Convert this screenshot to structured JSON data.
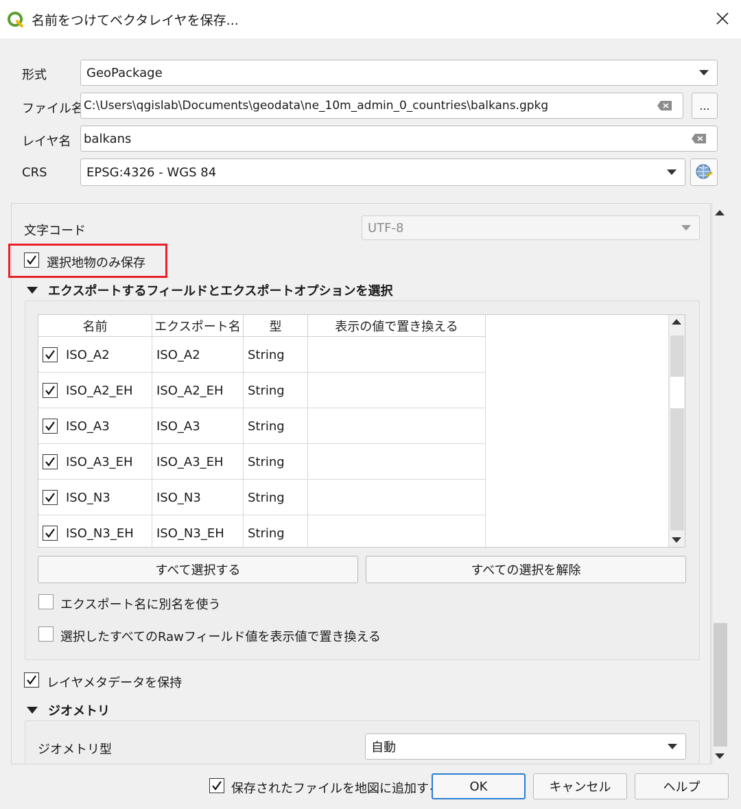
{
  "window": {
    "title": "名前をつけてベクタレイヤを保存..."
  },
  "format": {
    "label": "形式",
    "value": "GeoPackage"
  },
  "filename": {
    "label": "ファイル名",
    "value": "C:\\Users\\qgislab\\Documents\\geodata\\ne_10m_admin_0_countries\\balkans.gpkg",
    "browse_label": "..."
  },
  "layername": {
    "label": "レイヤ名",
    "value": "balkans"
  },
  "crs": {
    "label": "CRS",
    "value": "EPSG:4326 - WGS 84"
  },
  "encoding": {
    "label": "文字コード",
    "value": "UTF-8"
  },
  "selected_only": {
    "label": "選択地物のみ保存",
    "checked": true
  },
  "fields_section": {
    "title": "エクスポートするフィールドとエクスポートオプションを選択",
    "columns": [
      "名前",
      "エクスポート名",
      "型",
      "表示の値で置き換える"
    ],
    "rows": [
      {
        "name": "ISO_A2",
        "export": "ISO_A2",
        "type": "String"
      },
      {
        "name": "ISO_A2_EH",
        "export": "ISO_A2_EH",
        "type": "String"
      },
      {
        "name": "ISO_A3",
        "export": "ISO_A3",
        "type": "String"
      },
      {
        "name": "ISO_A3_EH",
        "export": "ISO_A3_EH",
        "type": "String"
      },
      {
        "name": "ISO_N3",
        "export": "ISO_N3",
        "type": "String"
      },
      {
        "name": "ISO_N3_EH",
        "export": "ISO_N3_EH",
        "type": "String"
      }
    ],
    "select_all_label": "すべて選択する",
    "deselect_all_label": "すべての選択を解除",
    "alias_label": "エクスポート名に別名を使う",
    "replace_raw_label": "選択したすべてのRawフィールド値を表示値で置き換える"
  },
  "keep_metadata": {
    "label": "レイヤメタデータを保持",
    "checked": true
  },
  "geometry_section": {
    "title": "ジオメトリ",
    "type_label": "ジオメトリ型",
    "type_value": "自動"
  },
  "footer": {
    "add_to_map_label": "保存されたファイルを地図に追加する",
    "ok_label": "OK",
    "cancel_label": "キャンセル",
    "help_label": "ヘルプ"
  }
}
